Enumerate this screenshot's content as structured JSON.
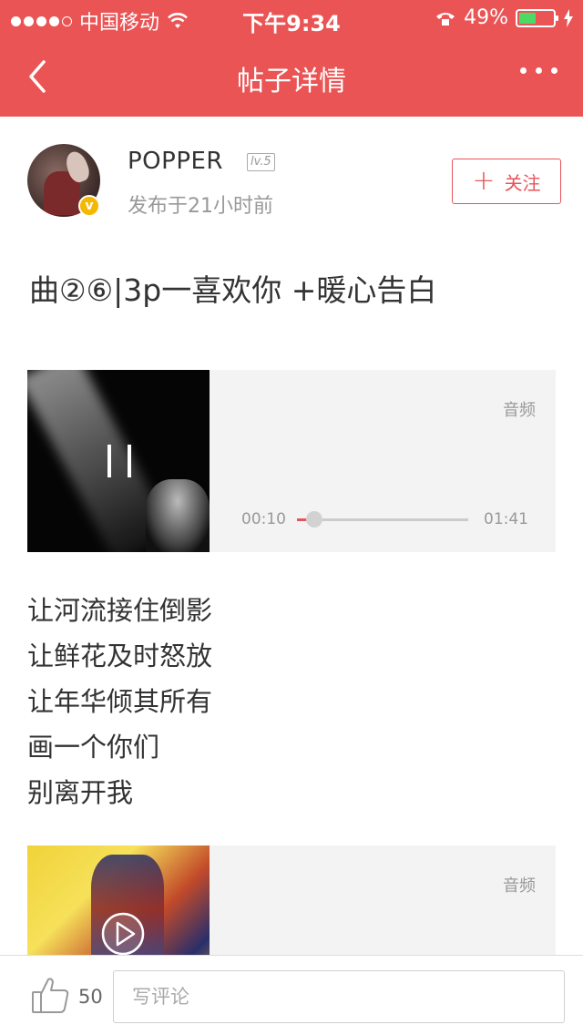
{
  "status_bar": {
    "carrier": "中国移动",
    "time": "下午9:34",
    "battery": "49%",
    "battery_level": 0.49
  },
  "nav": {
    "title": "帖子详情"
  },
  "author": {
    "name": "POPPER",
    "level": "lv.5",
    "verified_badge": "v",
    "post_time": "发布于21小时前",
    "follow_label": "关注"
  },
  "post": {
    "title": "曲②⑥|3p一喜欢你   +暖心告白"
  },
  "audio1": {
    "label": "音频",
    "current_time": "00:10",
    "total_time": "01:41",
    "progress": 0.1
  },
  "lyrics": [
    "让河流接住倒影",
    "让鲜花及时怒放",
    "让年华倾其所有",
    "画一个你们",
    "别离开我"
  ],
  "audio2": {
    "label": "音频"
  },
  "bottom_bar": {
    "like_count": "50",
    "comment_placeholder": "写评论"
  },
  "colors": {
    "brand": "#ea5455",
    "accent": "#e8545a",
    "verified": "#f5b800",
    "battery": "#4cd964"
  }
}
